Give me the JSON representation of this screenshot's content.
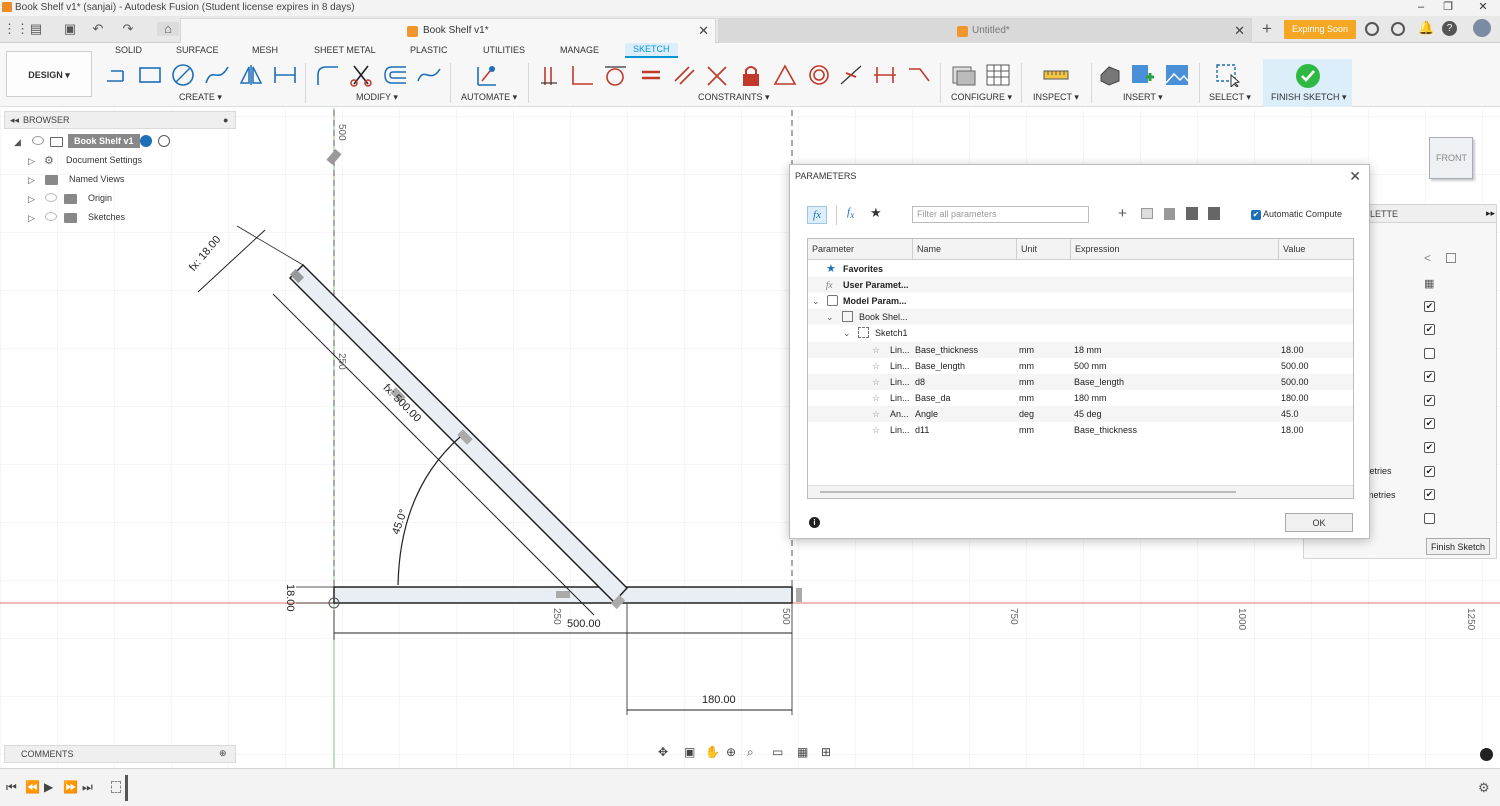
{
  "window": {
    "title": "Book Shelf v1* (sanjai) - Autodesk Fusion (Student license expires in 8 days)"
  },
  "tabs": {
    "active_doc": "Book Shelf v1*",
    "other_doc": "Untitled*",
    "expiring_label": "Expiring Soon"
  },
  "ribbon": {
    "workspace_label": "DESIGN",
    "workspace_caret": "▾",
    "tabs": [
      "SOLID",
      "SURFACE",
      "MESH",
      "SHEET METAL",
      "PLASTIC",
      "UTILITIES",
      "MANAGE",
      "SKETCH"
    ],
    "groups": {
      "create": "CREATE ▾",
      "modify": "MODIFY ▾",
      "automate": "AUTOMATE ▾",
      "constraints": "CONSTRAINTS ▾",
      "configure": "CONFIGURE ▾",
      "inspect": "INSPECT ▾",
      "insert": "INSERT ▾",
      "select": "SELECT ▾",
      "finish": "FINISH SKETCH ▾"
    },
    "accent": "#0696d7"
  },
  "browser": {
    "header": "BROWSER",
    "root": "Book Shelf v1",
    "items": [
      "Document Settings",
      "Named Views",
      "Origin",
      "Sketches"
    ]
  },
  "comments": {
    "label": "COMMENTS"
  },
  "dialog": {
    "title": "PARAMETERS",
    "filter_placeholder": "Filter all parameters",
    "auto_compute": "Automatic Compute",
    "columns": [
      "Parameter",
      "Name",
      "Unit",
      "Expression",
      "Value"
    ],
    "tree": {
      "favorites": "Favorites",
      "user": "User Paramet...",
      "model": "Model Param...",
      "component": "Book Shel...",
      "sketch": "Sketch1"
    },
    "rows": [
      {
        "param": "Lin...",
        "name": "Base_thickness",
        "unit": "mm",
        "expression": "18 mm",
        "value": "18.00"
      },
      {
        "param": "Lin...",
        "name": "Base_length",
        "unit": "mm",
        "expression": "500 mm",
        "value": "500.00"
      },
      {
        "param": "Lin...",
        "name": "d8",
        "unit": "mm",
        "expression": "Base_length",
        "value": "500.00"
      },
      {
        "param": "Lin...",
        "name": "Base_da",
        "unit": "mm",
        "expression": "180 mm",
        "value": "180.00"
      },
      {
        "param": "An...",
        "name": "Angle",
        "unit": "deg",
        "expression": "45 deg",
        "value": "45.0"
      },
      {
        "param": "Lin...",
        "name": "d11",
        "unit": "mm",
        "expression": "Base_thickness",
        "value": "18.00"
      }
    ],
    "ok_label": "OK"
  },
  "palette": {
    "title_fragment": "LETTE",
    "item1": "metries",
    "item2": "eometries",
    "finish_button": "Finish Sketch",
    "checks": [
      true,
      true,
      false,
      true,
      true,
      true,
      true,
      true,
      false
    ]
  },
  "viewcube": {
    "label": "FRONT"
  },
  "sketch": {
    "dim_thickness_top": "fx: 18.00",
    "dim_length_angled": "fx: 500.00",
    "dim_angle": "45.0°",
    "dim_thickness_left": "18.00",
    "dim_length_base": "500.00",
    "dim_offset": "180.00",
    "axis_labels": [
      "500",
      "250",
      "250",
      "500",
      "750",
      "1000",
      "1250"
    ]
  }
}
